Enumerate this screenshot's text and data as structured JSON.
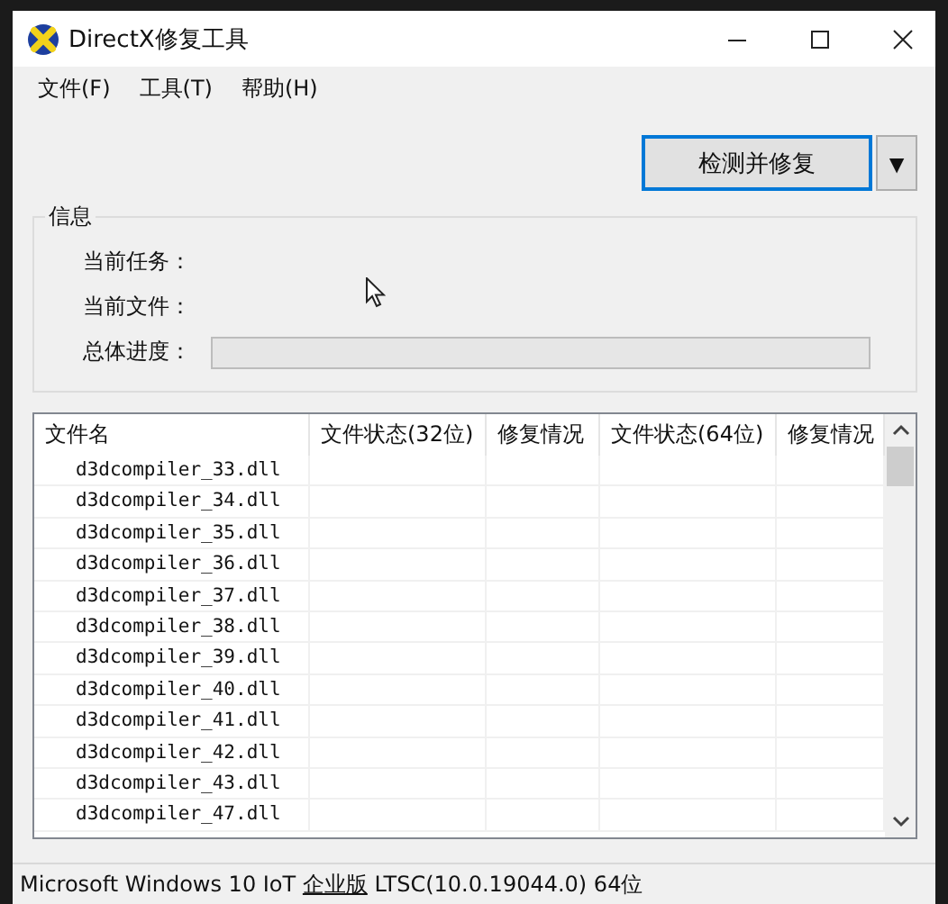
{
  "window": {
    "title": "DirectX修复工具"
  },
  "menu": [
    {
      "label": "文件(F)"
    },
    {
      "label": "工具(T)"
    },
    {
      "label": "帮助(H)"
    }
  ],
  "action_button": {
    "label": "检测并修复",
    "dropdown": "▼"
  },
  "info": {
    "title": "信息",
    "fields": [
      {
        "label": "当前任务："
      },
      {
        "label": "当前文件："
      }
    ],
    "progress": {
      "label": "总体进度：",
      "level": 0
    }
  },
  "table": {
    "columns": [
      "文件名",
      "文件状态(32位)",
      "修复情况",
      "文件状态(64位)",
      "修复情况"
    ],
    "rows": [
      "d3dcompiler_33.dll",
      "d3dcompiler_34.dll",
      "d3dcompiler_35.dll",
      "d3dcompiler_36.dll",
      "d3dcompiler_37.dll",
      "d3dcompiler_38.dll",
      "d3dcompiler_39.dll",
      "d3dcompiler_40.dll",
      "d3dcompiler_41.dll",
      "d3dcompiler_42.dll",
      "d3dcompiler_43.dll",
      "d3dcompiler_47.dll"
    ]
  },
  "status_bar": {
    "prefix": "Microsoft Windows 10 IoT ",
    "edition": "企业版",
    "suffix": " LTSC(10.0.19044.0) 64位"
  }
}
